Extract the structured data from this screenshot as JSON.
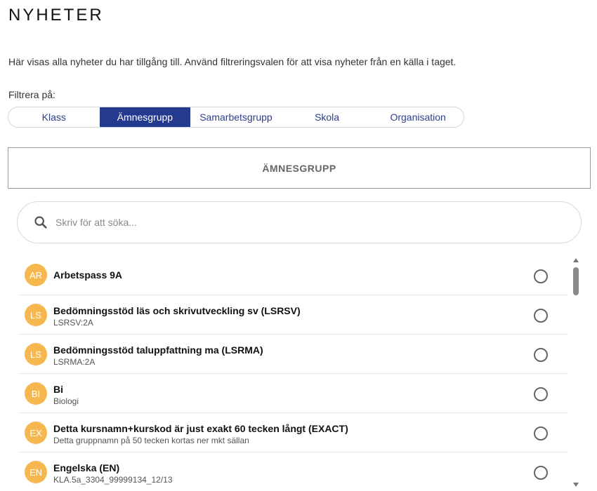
{
  "page": {
    "title": "NYHETER",
    "description": "Här visas alla nyheter du har tillgång till. Använd filtreringsvalen för att visa nyheter från en källa i taget.",
    "filter_label": "Filtrera på:"
  },
  "filter_tabs": [
    {
      "label": "Klass",
      "active": false
    },
    {
      "label": "Ämnesgrupp",
      "active": true
    },
    {
      "label": "Samarbetsgrupp",
      "active": false
    },
    {
      "label": "Skola",
      "active": false
    },
    {
      "label": "Organisation",
      "active": false
    }
  ],
  "section": {
    "heading": "ÄMNESGRUPP"
  },
  "search": {
    "placeholder": "Skriv för att söka...",
    "icon": "search-icon"
  },
  "colors": {
    "accent": "#233a8f",
    "avatar": "#f6b84e"
  },
  "items": [
    {
      "initials": "AR",
      "name": "Arbetspass 9A",
      "sub": ""
    },
    {
      "initials": "LS",
      "name": "Bedömningsstöd läs och skrivutveckling sv (LSRSV)",
      "sub": "LSRSV:2A"
    },
    {
      "initials": "LS",
      "name": "Bedömningsstöd taluppfattning ma (LSRMA)",
      "sub": "LSRMA:2A"
    },
    {
      "initials": "BI",
      "name": "Bi",
      "sub": "Biologi"
    },
    {
      "initials": "EX",
      "name": "Detta kursnamn+kurskod är just exakt 60 tecken långt (EXACT)",
      "sub": "Detta gruppnamn på 50 tecken kortas ner mkt sällan"
    },
    {
      "initials": "EN",
      "name": "Engelska (EN)",
      "sub": "KLA.5a_3304_99999134_12/13"
    }
  ]
}
